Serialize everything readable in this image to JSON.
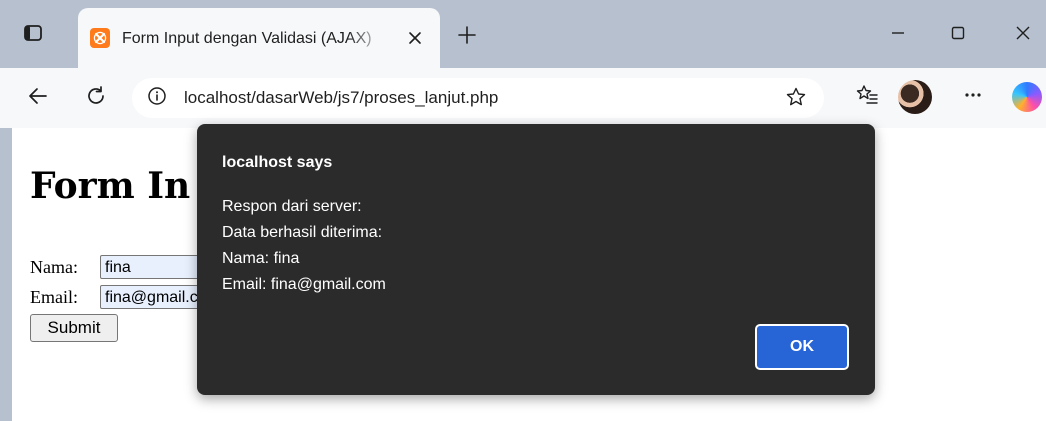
{
  "browser": {
    "tab": {
      "title": "Form Input dengan Validasi (AJAX)"
    },
    "address_bar": {
      "url": "localhost/dasarWeb/js7/proses_lanjut.php"
    }
  },
  "page": {
    "heading": "Form In",
    "form": {
      "nama_label": "Nama:",
      "nama_value": "fina",
      "email_label": "Email:",
      "email_value": "fina@gmail.com",
      "submit_label": "Submit"
    }
  },
  "dialog": {
    "title": "localhost says",
    "lines": [
      "Respon dari server:",
      "Data berhasil diterima:",
      "Nama: fina",
      "Email: fina@gmail.com"
    ],
    "ok_label": "OK"
  },
  "icons": {
    "tab_panel": "tab-panel-icon",
    "favicon": "xampp-favicon",
    "tab_close": "close-icon",
    "new_tab": "plus-icon",
    "minimize": "minimize-icon",
    "maximize": "maximize-icon",
    "window_close": "close-icon",
    "back": "arrow-left-icon",
    "reload": "reload-icon",
    "site_info": "info-icon",
    "favorite": "star-icon",
    "favorites": "favorites-list-icon",
    "more": "more-icon",
    "copilot": "copilot-icon"
  },
  "colors": {
    "titlebar": "#b6c0cf",
    "toolbar": "#f7f8fa",
    "dialog_bg": "#2b2b2b",
    "ok_button": "#2764d6",
    "autofill": "#e8f0fe"
  }
}
